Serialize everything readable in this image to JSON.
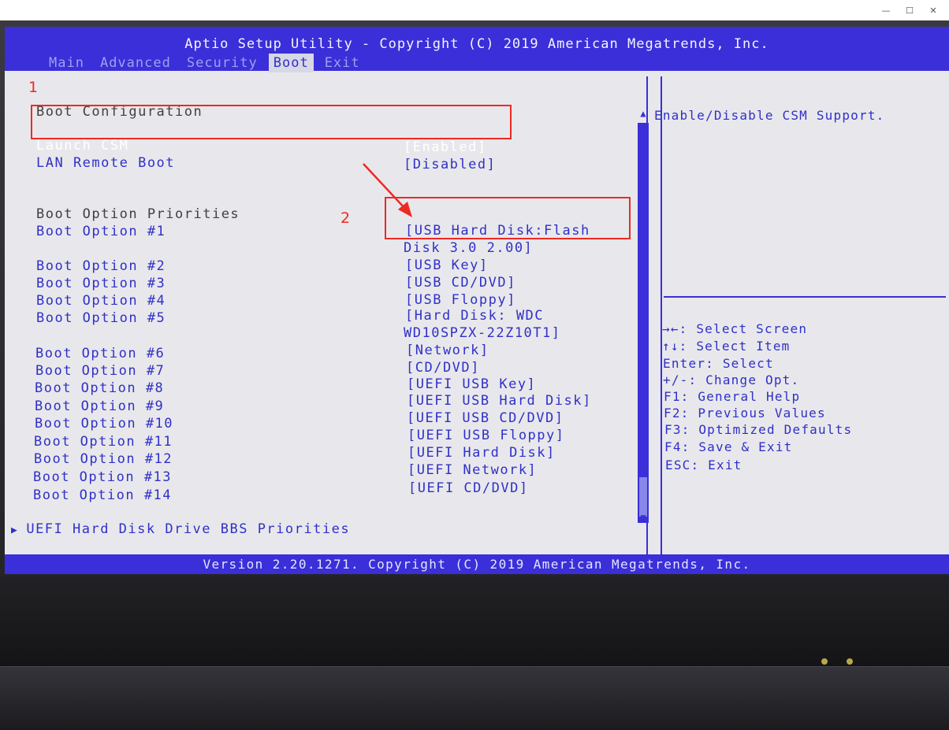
{
  "window": {
    "minimize_icon": "—",
    "maximize_icon": "☐",
    "close_icon": "✕"
  },
  "bios": {
    "title": "Aptio Setup Utility - Copyright (C) 2019 American Megatrends, Inc.",
    "tabs": [
      "Main",
      "Advanced",
      "Security",
      "Boot",
      "Exit"
    ],
    "active_tab": "Boot",
    "footer": "Version 2.20.1271. Copyright (C) 2019 American Megatrends, Inc.",
    "colors": {
      "primary_blue": "#3a2fd8",
      "text_blue": "#3030c8",
      "background": "#e8e8ec",
      "annotation_red": "#ee2a24"
    }
  },
  "boot": {
    "section_title": "Boot Configuration",
    "launch_csm": {
      "label": "Launch CSM",
      "value": "[Enabled]"
    },
    "lan_remote_boot": {
      "label": "LAN Remote Boot",
      "value": "[Disabled]"
    },
    "priorities_title": "Boot Option Priorities",
    "options": [
      {
        "label": "Boot Option #1",
        "value_line1": "[USB Hard Disk:Flash",
        "value_line2": "Disk 3.0 2.00]"
      },
      {
        "label": "Boot Option #2",
        "value_line1": "[USB Key]"
      },
      {
        "label": "Boot Option #3",
        "value_line1": "[USB CD/DVD]"
      },
      {
        "label": "Boot Option #4",
        "value_line1": "[USB Floppy]"
      },
      {
        "label": "Boot Option #5",
        "value_line1": "[Hard Disk: WDC",
        "value_line2": "WD10SPZX-22Z10T1]"
      },
      {
        "label": "Boot Option #6",
        "value_line1": "[Network]"
      },
      {
        "label": "Boot Option #7",
        "value_line1": "[CD/DVD]"
      },
      {
        "label": "Boot Option #8",
        "value_line1": "[UEFI USB Key]"
      },
      {
        "label": "Boot Option #9",
        "value_line1": "[UEFI USB Hard Disk]"
      },
      {
        "label": "Boot Option #10",
        "value_line1": "[UEFI USB CD/DVD]"
      },
      {
        "label": "Boot Option #11",
        "value_line1": "[UEFI USB Floppy]"
      },
      {
        "label": "Boot Option #12",
        "value_line1": "[UEFI Hard Disk]"
      },
      {
        "label": "Boot Option #13",
        "value_line1": "[UEFI Network]"
      },
      {
        "label": "Boot Option #14",
        "value_line1": "[UEFI CD/DVD]"
      }
    ],
    "submenu": "UEFI Hard Disk Drive BBS Priorities"
  },
  "help": {
    "description": "Enable/Disable CSM Support.",
    "keys": [
      "→←: Select Screen",
      "↑↓: Select Item",
      "Enter: Select",
      "+/-: Change Opt.",
      "F1: General Help",
      "F2: Previous Values",
      "F3: Optimized Defaults",
      "F4: Save & Exit",
      "ESC: Exit"
    ]
  },
  "annotations": {
    "marker_1": "1",
    "marker_2": "2"
  }
}
